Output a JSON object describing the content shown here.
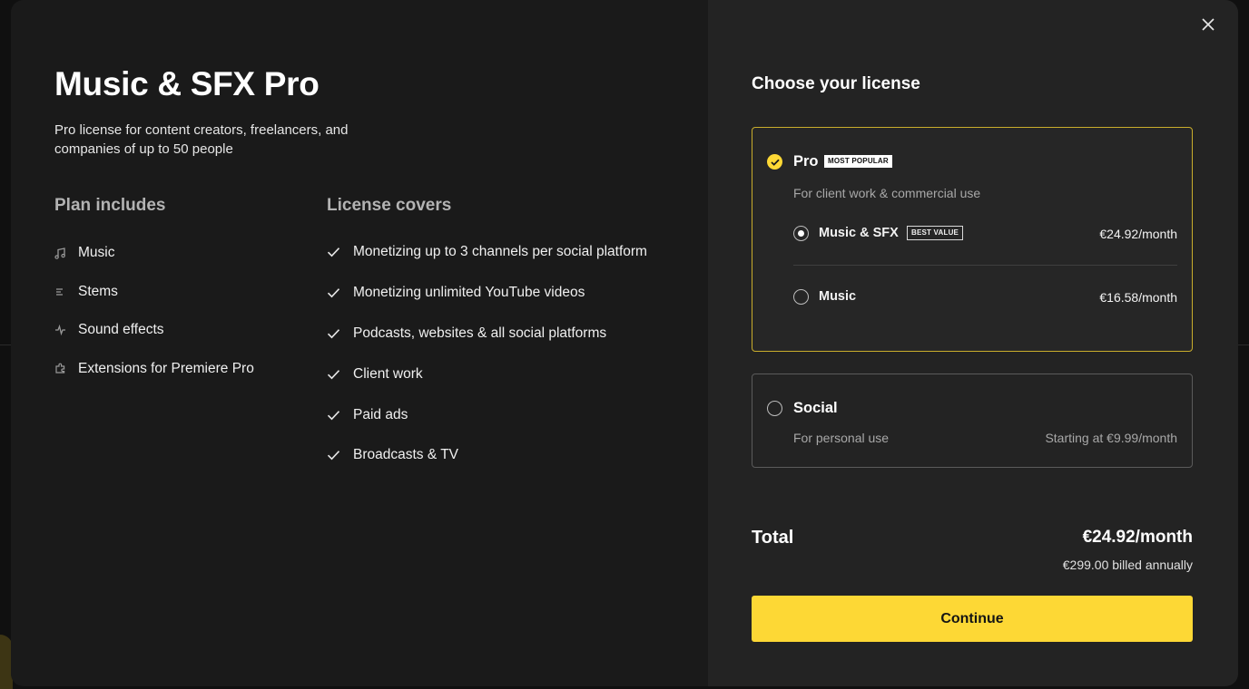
{
  "modal": {
    "title": "Music & SFX Pro",
    "subtitle": "Pro license for content creators, freelancers, and companies of up to 50 people"
  },
  "plan": {
    "heading": "Plan includes",
    "items": [
      {
        "label": "Music",
        "icon": "music-note-icon"
      },
      {
        "label": "Stems",
        "icon": "stems-icon"
      },
      {
        "label": "Sound effects",
        "icon": "sparkle-icon"
      },
      {
        "label": "Extensions for Premiere Pro",
        "icon": "extension-icon"
      }
    ]
  },
  "license": {
    "heading": "License covers",
    "items": [
      "Monetizing up to 3 channels per social platform",
      "Monetizing unlimited YouTube videos",
      "Podcasts, websites & all social platforms",
      "Client work",
      "Paid ads",
      "Broadcasts & TV"
    ]
  },
  "choose": {
    "heading": "Choose your license",
    "pro": {
      "title": "Pro",
      "badge": "MOST POPULAR",
      "desc": "For client work & commercial use",
      "options": [
        {
          "label": "Music & SFX",
          "badge": "BEST VALUE",
          "price": "€24.92/month",
          "selected": true
        },
        {
          "label": "Music",
          "price": "€16.58/month",
          "selected": false
        }
      ]
    },
    "social": {
      "title": "Social",
      "desc": "For personal use",
      "price": "Starting at €9.99/month"
    }
  },
  "total": {
    "label": "Total",
    "price": "€24.92/month",
    "billed": "€299.00 billed annually"
  },
  "continue_label": "Continue",
  "colors": {
    "accent": "#fdd835",
    "selected_border": "#c9ad2c",
    "left_panel": "#1a1a1a",
    "right_panel": "#232323"
  }
}
